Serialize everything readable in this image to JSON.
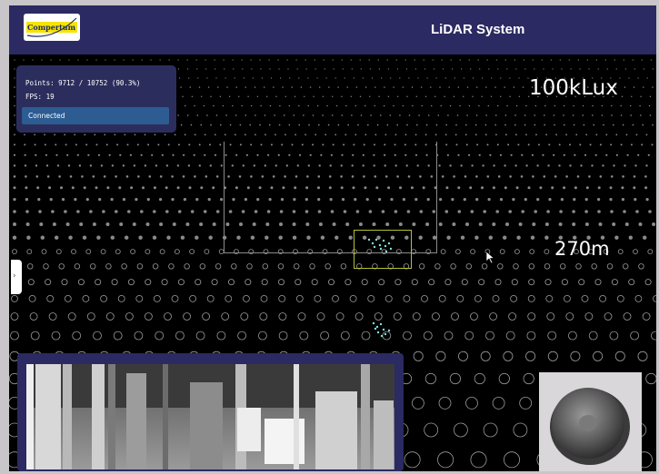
{
  "header": {
    "logo_text": "Compertum",
    "title": "LiDAR System"
  },
  "stats": {
    "points_line": "Points: 9712 / 10752 (90.3%)",
    "fps_line": "FPS: 19",
    "status": "Connected"
  },
  "overlay": {
    "illuminance": "100kLux",
    "range": "270m"
  },
  "side_handle": {
    "glyph": "›"
  },
  "colors": {
    "header": "#2c2a62",
    "status_bar": "#2c5c92",
    "target_box": "#b8c033",
    "point_cloud": "#7fe0e0"
  },
  "icons": {
    "cursor": "mouse-pointer-icon",
    "handle": "chevron-right-icon"
  }
}
